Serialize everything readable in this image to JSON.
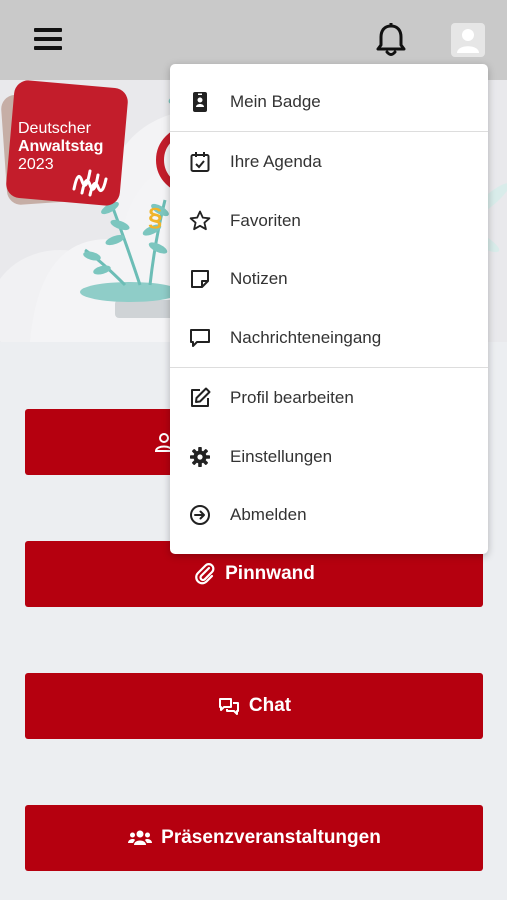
{
  "header": {
    "menu_icon": "hamburger-icon",
    "notification_icon": "bell-icon",
    "profile_icon": "user-avatar-icon"
  },
  "logo": {
    "line1": "Deutscher",
    "line2": "Anwaltstag",
    "line3": "2023",
    "color": "#c31d2b"
  },
  "hero": {
    "symbol": "§"
  },
  "dropdown": {
    "items": [
      {
        "label": "Mein Badge",
        "icon": "badge-icon"
      },
      {
        "label": "Ihre Agenda",
        "icon": "calendar-check-icon"
      },
      {
        "label": "Favoriten",
        "icon": "star-icon"
      },
      {
        "label": "Notizen",
        "icon": "note-icon"
      },
      {
        "label": "Nachrichteneingang",
        "icon": "message-icon"
      },
      {
        "label": "Profil bearbeiten",
        "icon": "edit-icon"
      },
      {
        "label": "Einstellungen",
        "icon": "gear-icon"
      },
      {
        "label": "Abmelden",
        "icon": "logout-icon"
      }
    ]
  },
  "buttons": {
    "pinnwand": "Pinnwand",
    "chat": "Chat",
    "praesenz": "Präsenzveranstaltungen",
    "accent": "#b5000f"
  }
}
